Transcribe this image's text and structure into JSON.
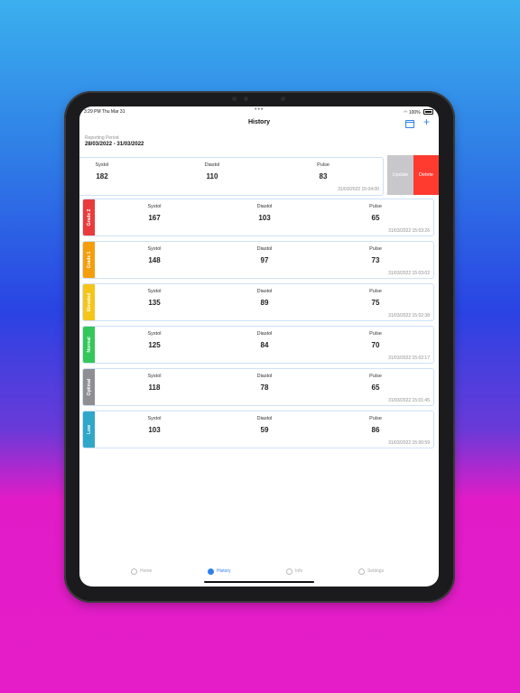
{
  "status_bar": {
    "time": "3:29 PM  Thu Mar 31",
    "dots": "•••",
    "battery": "100%"
  },
  "nav": {
    "title": "History"
  },
  "reporting": {
    "label": "Reporting Period",
    "value": "28/03/2022 - 31/03/2022"
  },
  "swipe_actions": {
    "update": "Update",
    "delete": "Delete"
  },
  "column_labels": {
    "systol": "Systol",
    "diastol": "Diastol",
    "pulse": "Pulse"
  },
  "swiped_record": {
    "systol": "182",
    "diastol": "110",
    "pulse": "83",
    "timestamp": "31/03/2022  15:04:00"
  },
  "records": [
    {
      "grade": "Grade 2",
      "color": "#ea3b3b",
      "systol": "167",
      "diastol": "103",
      "pulse": "65",
      "timestamp": "31/03/2022  15:03:26"
    },
    {
      "grade": "Grade 1",
      "color": "#f59e0b",
      "systol": "148",
      "diastol": "97",
      "pulse": "73",
      "timestamp": "31/03/2022  15:03:02"
    },
    {
      "grade": "Elevated",
      "color": "#f5c518",
      "systol": "135",
      "diastol": "89",
      "pulse": "75",
      "timestamp": "31/03/2022  15:02:38"
    },
    {
      "grade": "Normal",
      "color": "#34c759",
      "systol": "125",
      "diastol": "84",
      "pulse": "70",
      "timestamp": "31/03/2022  15:02:17"
    },
    {
      "grade": "Optimal",
      "color": "#8e8e93",
      "systol": "118",
      "diastol": "78",
      "pulse": "65",
      "timestamp": "31/03/2022  15:01:45"
    },
    {
      "grade": "Low",
      "color": "#30a7c9",
      "systol": "103",
      "diastol": "59",
      "pulse": "86",
      "timestamp": "31/03/2022  15:00:59"
    }
  ],
  "tabs": [
    {
      "label": "Home",
      "icon": "home-icon"
    },
    {
      "label": "History",
      "icon": "history-icon"
    },
    {
      "label": "Info",
      "icon": "info-icon"
    },
    {
      "label": "Settings",
      "icon": "settings-icon"
    }
  ]
}
